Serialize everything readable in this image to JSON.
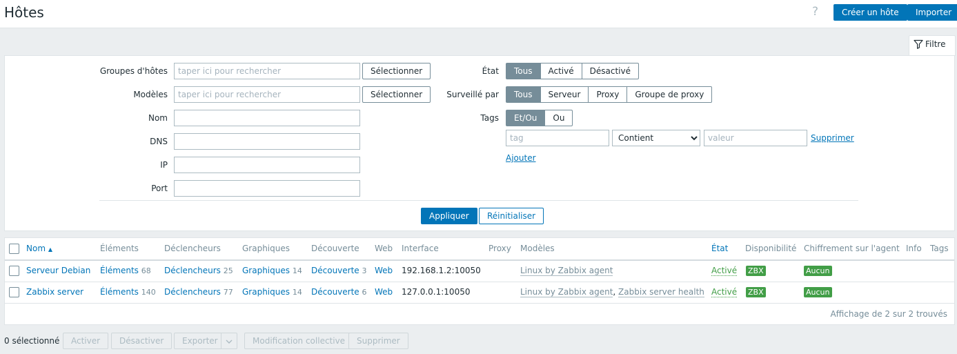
{
  "header": {
    "title": "Hôtes",
    "help_icon": "?",
    "create_label": "Créer un hôte",
    "import_label": "Importer"
  },
  "filter": {
    "tab_label": "Filtre",
    "host_groups_label": "Groupes d'hôtes",
    "host_groups_placeholder": "taper ici pour rechercher",
    "templates_label": "Modèles",
    "templates_placeholder": "taper ici pour rechercher",
    "select_label": "Sélectionner",
    "name_label": "Nom",
    "dns_label": "DNS",
    "ip_label": "IP",
    "port_label": "Port",
    "state_label": "État",
    "state_options": [
      "Tous",
      "Activé",
      "Désactivé"
    ],
    "monitored_by_label": "Surveillé par",
    "monitored_by_options": [
      "Tous",
      "Serveur",
      "Proxy",
      "Groupe de proxy"
    ],
    "tags_label": "Tags",
    "tags_options": [
      "Et/Ou",
      "Ou"
    ],
    "tag_placeholder": "tag",
    "operator_value": "Contient",
    "value_placeholder": "valeur",
    "remove_label": "Supprimer",
    "add_label": "Ajouter",
    "apply_label": "Appliquer",
    "reset_label": "Réinitialiser"
  },
  "table": {
    "columns": {
      "name": "Nom",
      "items": "Éléments",
      "triggers": "Déclencheurs",
      "graphs": "Graphiques",
      "discovery": "Découverte",
      "web": "Web",
      "interface": "Interface",
      "proxy": "Proxy",
      "templates": "Modèles",
      "state": "État",
      "availability": "Disponibilité",
      "encryption": "Chiffrement sur l'agent",
      "info": "Info",
      "tags": "Tags"
    },
    "sort_indicator": "▲",
    "rows": [
      {
        "name": "Serveur Debian",
        "items_label": "Éléments",
        "items_count": "68",
        "triggers_label": "Déclencheurs",
        "triggers_count": "25",
        "graphs_label": "Graphiques",
        "graphs_count": "14",
        "discovery_label": "Découverte",
        "discovery_count": "3",
        "web": "Web",
        "interface": "192.168.1.2:10050",
        "template_1": "Linux by Zabbix agent",
        "state": "Activé",
        "availability": "ZBX",
        "encryption": "Aucun"
      },
      {
        "name": "Zabbix server",
        "items_label": "Éléments",
        "items_count": "140",
        "triggers_label": "Déclencheurs",
        "triggers_count": "77",
        "graphs_label": "Graphiques",
        "graphs_count": "14",
        "discovery_label": "Découverte",
        "discovery_count": "6",
        "web": "Web",
        "interface": "127.0.0.1:10050",
        "template_1": "Linux by Zabbix agent",
        "template_sep": ", ",
        "template_2": "Zabbix server health",
        "state": "Activé",
        "availability": "ZBX",
        "encryption": "Aucun"
      }
    ],
    "footer": "Affichage de 2 sur 2 trouvés"
  },
  "actions": {
    "selected_count": "0 sélectionné",
    "enable": "Activer",
    "disable": "Désactiver",
    "export": "Exporter",
    "mass_update": "Modification collective",
    "delete": "Supprimer"
  },
  "colors": {
    "primary": "#0275b8",
    "success": "#429e47",
    "muted": "#768d99"
  }
}
